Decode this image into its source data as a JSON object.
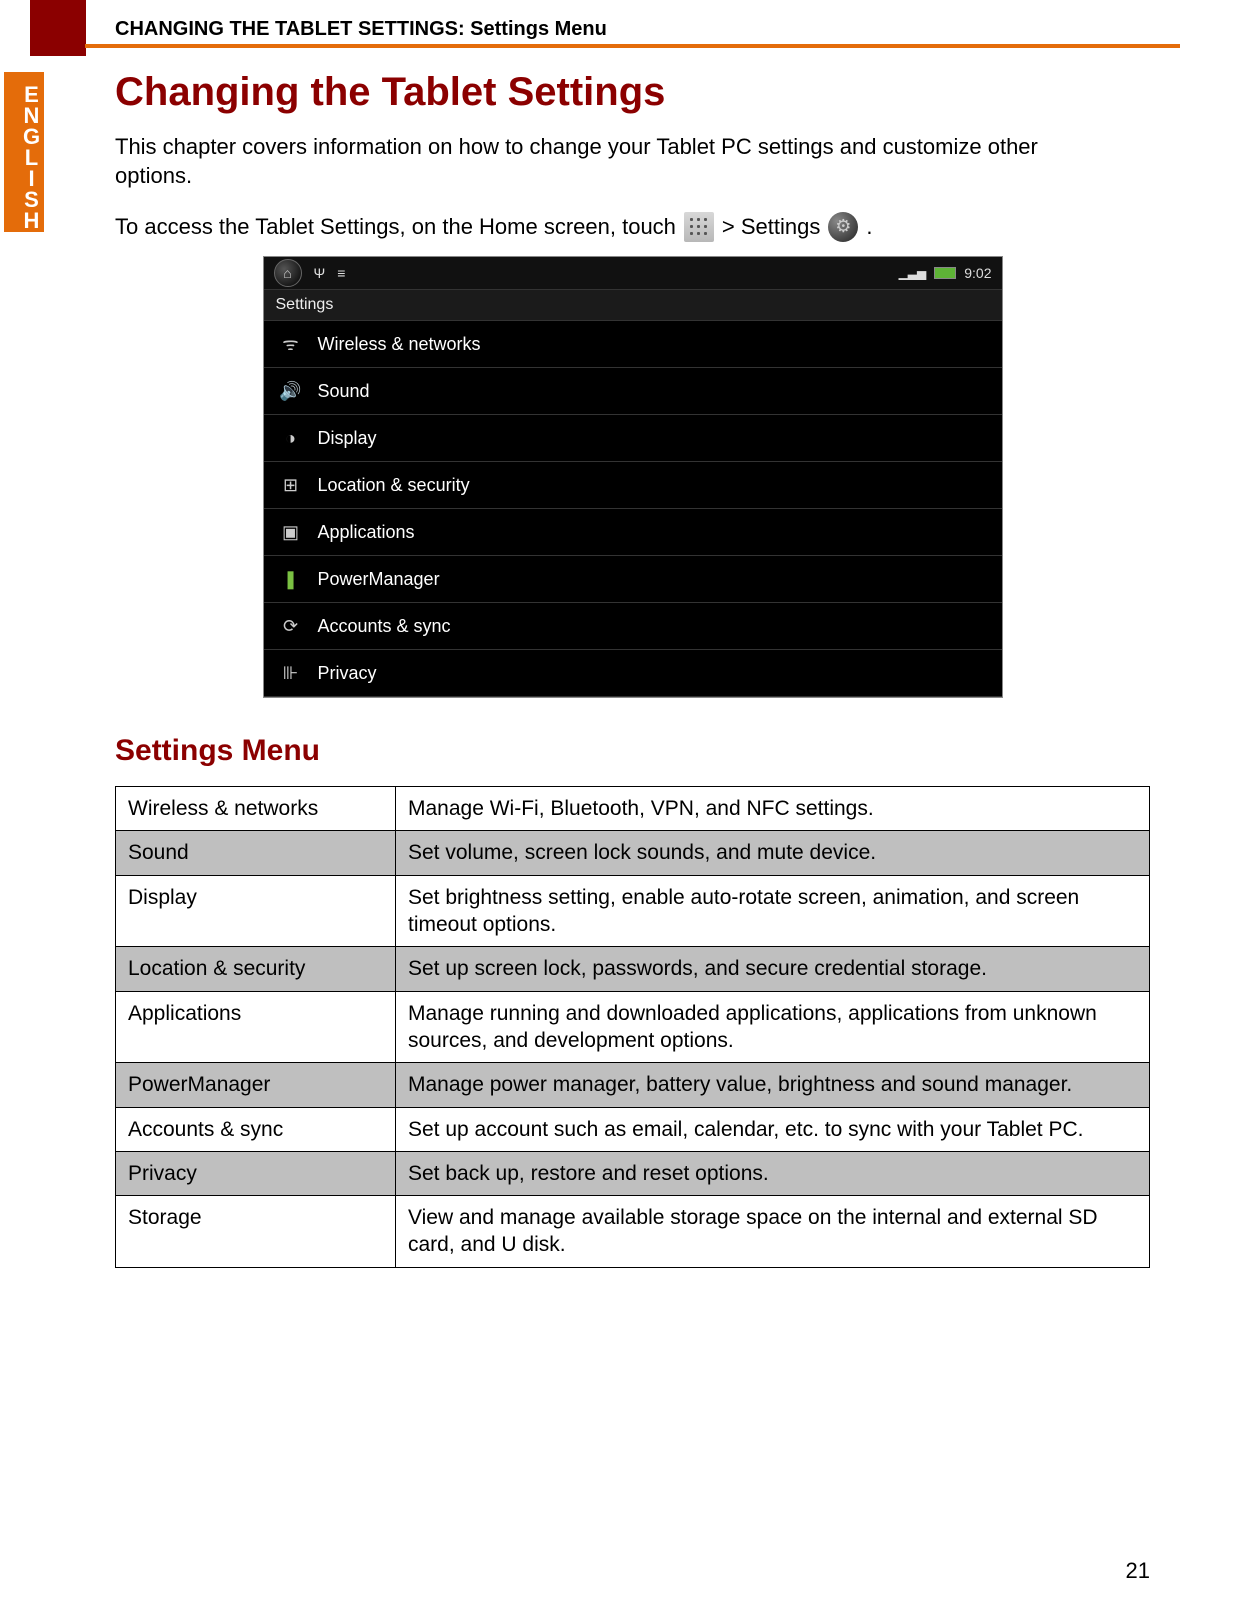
{
  "header": {
    "running_head": "CHANGING THE TABLET SETTINGS: Settings Menu"
  },
  "side_tab": "ENGLISH",
  "title": "Changing the Tablet Settings",
  "intro": "This chapter covers information on how to change your Tablet PC settings and customize other options.",
  "access_line": {
    "pre": "To access the Tablet Settings, on the Home screen, touch ",
    "mid": "> Settings",
    "post": "."
  },
  "screenshot": {
    "clock": "9:02",
    "title": "Settings",
    "items": [
      {
        "icon": "wifi",
        "glyph": "ᯤ",
        "label": "Wireless & networks"
      },
      {
        "icon": "sound",
        "glyph": "🔊",
        "label": "Sound"
      },
      {
        "icon": "display",
        "glyph": "◑",
        "label": "Display"
      },
      {
        "icon": "location",
        "glyph": "⊞",
        "label": "Location & security"
      },
      {
        "icon": "apps",
        "glyph": "▣",
        "label": "Applications"
      },
      {
        "icon": "power",
        "glyph": "❚",
        "label": "PowerManager"
      },
      {
        "icon": "sync",
        "glyph": "⟳",
        "label": "Accounts & sync"
      },
      {
        "icon": "privacy",
        "glyph": "⊪",
        "label": "Privacy"
      }
    ]
  },
  "subheading": "Settings Menu",
  "table": [
    {
      "name": "Wireless & networks",
      "desc": "Manage Wi-Fi, Bluetooth, VPN, and NFC settings.",
      "shaded": false
    },
    {
      "name": "Sound",
      "desc": "Set volume, screen lock sounds, and mute device.",
      "shaded": true
    },
    {
      "name": "Display",
      "desc": "Set brightness setting, enable auto-rotate screen, animation, and screen timeout options.",
      "shaded": false
    },
    {
      "name": "Location & security",
      "desc": "Set up screen lock, passwords, and secure credential storage.",
      "shaded": true
    },
    {
      "name": "Applications",
      "desc": "Manage running and downloaded applications, applications from unknown sources, and development options.",
      "shaded": false
    },
    {
      "name": "PowerManager",
      "desc": "Manage power manager, battery value, brightness and sound manager.",
      "shaded": true
    },
    {
      "name": "Accounts & sync",
      "desc": "Set up account such as email, calendar, etc. to sync with your Tablet PC.",
      "shaded": false
    },
    {
      "name": "Privacy",
      "desc": "Set back up, restore and reset options.",
      "shaded": true
    },
    {
      "name": "Storage",
      "desc": "View and manage available storage space on the internal and external SD card, and U disk.",
      "shaded": false
    }
  ],
  "page_number": "21"
}
